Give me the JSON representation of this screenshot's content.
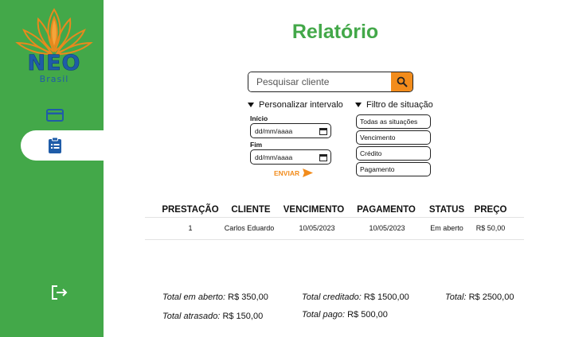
{
  "brand": {
    "name": "NEO",
    "sub": "Brasil"
  },
  "page": {
    "title": "Relatório"
  },
  "search": {
    "placeholder": "Pesquisar cliente",
    "value": ""
  },
  "interval": {
    "toggle_label": "Personalizar intervalo",
    "start_label": "Início",
    "start_value": "dd/mm/aaaa",
    "end_label": "Fim",
    "end_value": "dd/mm/aaaa",
    "send_label": "ENVIAR"
  },
  "status_filter": {
    "toggle_label": "Filtro de situação",
    "options": [
      "Todas as situações",
      "Vencimento",
      "Crédito",
      "Pagamento"
    ]
  },
  "table": {
    "headers": [
      "PRESTAÇÃO",
      "CLIENTE",
      "VENCIMENTO",
      "PAGAMENTO",
      "STATUS",
      "PREÇO"
    ],
    "rows": [
      [
        "1",
        "Carlos Eduardo",
        "10/05/2023",
        "10/05/2023",
        "Em aberto",
        "R$ 50,00"
      ]
    ]
  },
  "totals": {
    "open_label": "Total em aberto:",
    "open_value": "R$ 350,00",
    "late_label": "Total atrasado:",
    "late_value": "R$ 150,00",
    "credited_label": "Total creditado:",
    "credited_value": "R$ 1500,00",
    "paid_label": "Total pago:",
    "paid_value": "R$ 500,00",
    "total_label": "Total:",
    "total_value": "R$ 2500,00"
  },
  "colors": {
    "brand_green": "#43a849",
    "accent_orange": "#f28c1c",
    "logo_blue": "#1f5ca8"
  },
  "icons": [
    "lotus-logo",
    "credit-card-icon",
    "clipboard-icon",
    "logout-icon",
    "search-icon",
    "calendar-icon",
    "send-arrow-icon",
    "triangle-down-icon"
  ]
}
